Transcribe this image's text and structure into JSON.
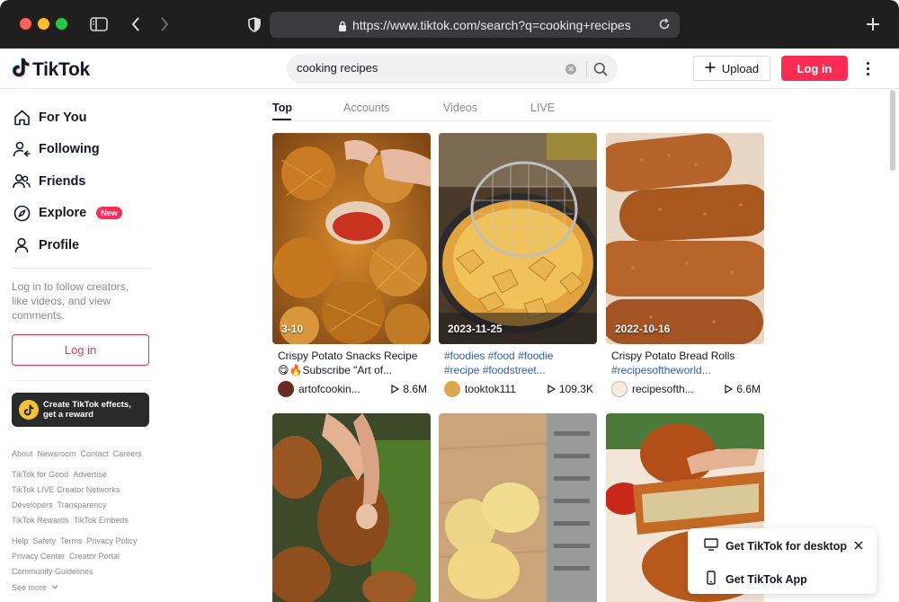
{
  "browser": {
    "url": "https://www.tiktok.com/search?q=cooking+recipes"
  },
  "header": {
    "logo_text": "TikTok",
    "search_value": "cooking recipes",
    "upload_label": "Upload",
    "login_label": "Log in"
  },
  "sidebar": {
    "items": [
      {
        "label": "For You",
        "icon": "home-icon"
      },
      {
        "label": "Following",
        "icon": "following-icon"
      },
      {
        "label": "Friends",
        "icon": "friends-icon"
      },
      {
        "label": "Explore",
        "icon": "compass-icon",
        "badge": "New"
      },
      {
        "label": "Profile",
        "icon": "profile-icon"
      }
    ],
    "login_hint": "Log in to follow creators, like videos, and view comments.",
    "login_label": "Log in",
    "effects_banner": "Create TikTok effects, get a reward",
    "footer": {
      "row1": [
        "About",
        "Newsroom",
        "Contact",
        "Careers"
      ],
      "row2": [
        "TikTok for Good",
        "Advertise"
      ],
      "row3": [
        "TikTok LIVE Creator Networks"
      ],
      "row4": [
        "Developers",
        "Transparency"
      ],
      "row5": [
        "TikTok Rewards",
        "TikTok Embeds"
      ],
      "row6": [
        "Help",
        "Safety",
        "Terms",
        "Privacy Policy"
      ],
      "row7": [
        "Privacy Center",
        "Creator Portal"
      ],
      "row8": [
        "Community Guidelines"
      ],
      "see_more": "See more"
    }
  },
  "tabs": [
    "Top",
    "Accounts",
    "Videos",
    "LIVE"
  ],
  "results": [
    {
      "date": "3-10",
      "overlay_caption": "Crispy Potato Snacks",
      "desc_line1": "Crispy Potato Snacks Recipe",
      "desc_line2": "😋🔥Subscribe \"Art of...",
      "user": "artofcookin...",
      "views": "8.6M"
    },
    {
      "date": "2023-11-25",
      "desc_line1": "#foodies #food #foodie",
      "desc_line2": "#recipe #foodstreet...",
      "user": "tooktok111",
      "views": "109.3K"
    },
    {
      "date": "2022-10-16",
      "desc_line1": "Crispy Potato Bread Rolls",
      "desc_line2": "#recipesoftheworld...",
      "user": "recipesofth...",
      "views": "6.6M"
    }
  ],
  "popup": {
    "desktop_label": "Get TikTok for desktop",
    "app_label": "Get TikTok App"
  },
  "colors": {
    "brand": "#fe2c55",
    "hashtag": "#2b5db9",
    "text": "#161823",
    "muted": "#8a8b91"
  }
}
